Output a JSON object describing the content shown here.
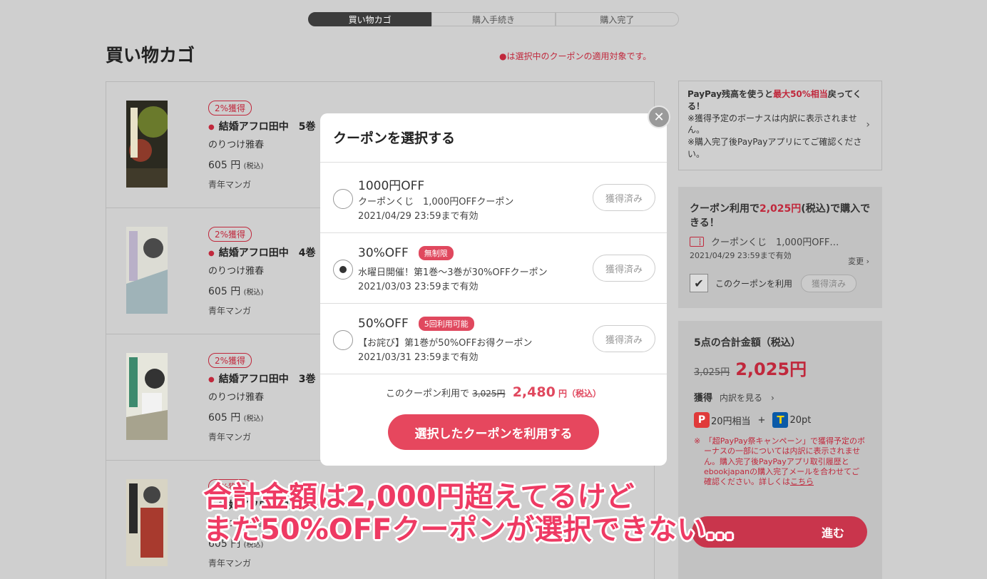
{
  "steps": [
    "買い物カゴ",
    "購入手続き",
    "購入完了"
  ],
  "page_title": "買い物カゴ",
  "target_note": "●は選択中のクーポンの適用対象です。",
  "cart_items": [
    {
      "badge": "2%獲得",
      "title": "結婚アフロ田中　5巻",
      "author": "のりつけ雅春",
      "price": "605",
      "price_unit": "円",
      "tax": "(税込)",
      "genre": "青年マンガ"
    },
    {
      "badge": "2%獲得",
      "title": "結婚アフロ田中　4巻",
      "author": "のりつけ雅春",
      "price": "605",
      "price_unit": "円",
      "tax": "(税込)",
      "genre": "青年マンガ"
    },
    {
      "badge": "2%獲得",
      "title": "結婚アフロ田中　3巻",
      "author": "のりつけ雅春",
      "price": "605",
      "price_unit": "円",
      "tax": "(税込)",
      "genre": "青年マンガ"
    },
    {
      "badge": "2%獲得",
      "title": "結婚アフロ田中",
      "author": "のりつけ雅春",
      "price": "605",
      "price_unit": "円",
      "tax": "(税込)",
      "genre": "青年マンガ"
    }
  ],
  "paypay": {
    "line1a": "PayPay残高を使うと",
    "line1b": "最大50%相当",
    "line1c": "戻ってくる！",
    "note1": "※獲得予定のボーナスは内訳に表示されません。",
    "note2": "※購入完了後PayPayアプリにてご確認ください。"
  },
  "coupon_panel": {
    "head_a": "クーポン利用で",
    "head_price": "2,025円",
    "head_b": "(税込)で購入できる！",
    "coupon_name": "クーポンくじ　1,000円OFF…",
    "date": "2021/04/29 23:59まで有効",
    "change": "変更 ›",
    "checkbox_mark": "✔",
    "use_label": "このクーポンを利用",
    "got_label": "獲得済み"
  },
  "total_panel": {
    "label": "5点の合計金額（税込）",
    "old_price": "3,025円",
    "new_price": "2,025円",
    "get_label": "獲得",
    "detail": "内訳を見る　›",
    "paypay_icon": "P",
    "paypay_bonus": "20円相当",
    "plus": "+",
    "t_icon": "T",
    "t_bonus": "20pt",
    "campaign_note": "※　「超PayPay祭キャンペーン」で獲得予定のボーナスの一部については内訳に表示されません。購入完了後PayPayアプリ取引履歴とebookjapanの購入完了メールを合わせてご確認ください。詳しくは",
    "campaign_link": "こちら",
    "proceed": "進む"
  },
  "modal": {
    "title": "クーポンを選択する",
    "close": "✕",
    "coupons": [
      {
        "name": "1000円OFF",
        "tag": "",
        "desc": "クーポンくじ　1,000円OFFクーポン",
        "date": "2021/04/29 23:59まで有効",
        "got": "獲得済み",
        "checked": false
      },
      {
        "name": "30%OFF",
        "tag": "無制限",
        "desc": "水曜日開催！第1巻～3巻が30%OFFクーポン",
        "date": "2021/03/03 23:59まで有効",
        "got": "獲得済み",
        "checked": true
      },
      {
        "name": "50%OFF",
        "tag": "5回利用可能",
        "desc": "【お詫び】第1巻が50%OFFお得クーポン",
        "date": "2021/03/31 23:59まで有効",
        "got": "獲得済み",
        "checked": false
      }
    ],
    "sum_prefix": "このクーポン利用で",
    "sum_old": "3,025円",
    "sum_new": "2,480",
    "sum_unit": "円（税込）",
    "apply": "選択したクーポンを利用する"
  },
  "caption": {
    "line1": "合計金額は2,000円超えてるけど",
    "line2": "まだ50%OFFクーポンが選択できない…"
  },
  "colors": {
    "accent": "#e6475e",
    "dark_red": "#c0283c",
    "background": "#cfcfcf"
  }
}
